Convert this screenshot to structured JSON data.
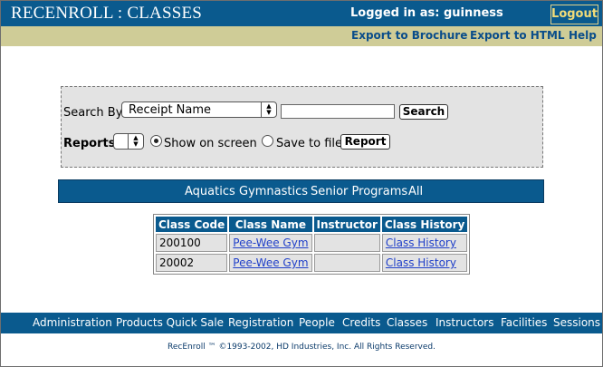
{
  "header": {
    "app_title": "RECENROLL : CLASSES",
    "logged_in": "Logged in as: guinness",
    "logout_label": "Logout"
  },
  "toolbar": {
    "export_brochure": "Export to Brochure",
    "export_html": "Export to HTML",
    "help": "Help"
  },
  "search": {
    "search_by_label": "Search By",
    "search_by_selected": "Receipt Name",
    "search_value": "",
    "search_button": "Search",
    "reports_label": "Reports",
    "reports_selected": "",
    "show_on_screen_label": "Show on screen",
    "show_on_screen_selected": true,
    "save_to_file_label": "Save to file",
    "save_to_file_selected": false,
    "report_button": "Report"
  },
  "categories": [
    "Aquatics",
    "Gymnastics",
    "Senior Programs",
    "All"
  ],
  "table": {
    "columns": [
      "Class Code",
      "Class Name",
      "Instructor",
      "Class History"
    ],
    "rows": [
      {
        "code": "200100",
        "name": "Pee-Wee Gym",
        "instructor": "",
        "history": "Class History"
      },
      {
        "code": "20002",
        "name": "Pee-Wee Gym",
        "instructor": "",
        "history": "Class History"
      }
    ]
  },
  "footer_nav": [
    "Administration",
    "Products Quick Sale",
    "Registration",
    "People",
    "Credits",
    "Classes",
    "Instructors",
    "Facilities",
    "Sessions"
  ],
  "copyright": "RecEnroll ™ ©1993-2002, HD Industries, Inc.  All Rights Reserved.",
  "colors": {
    "header_blue": "#0a5a8e",
    "toolbar_khaki": "#cfcc97",
    "logout_gold": "#f2dc78",
    "link_blue": "#1f3fc9"
  }
}
